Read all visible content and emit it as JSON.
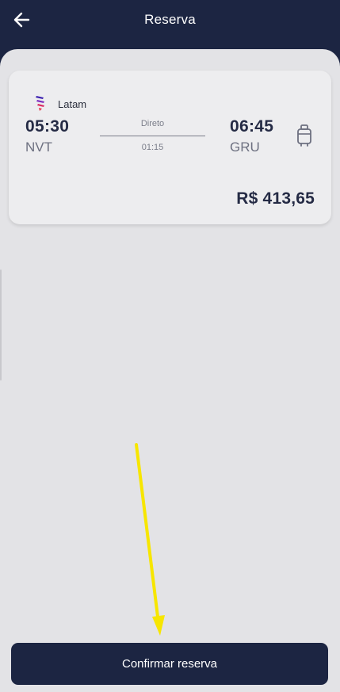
{
  "header": {
    "title": "Reserva",
    "back_icon": "arrow-left-icon"
  },
  "flight": {
    "airline": "Latam",
    "airline_logo": "latam-logo",
    "departure_time": "05:30",
    "departure_code": "NVT",
    "arrival_time": "06:45",
    "arrival_code": "GRU",
    "stops": "Direto",
    "duration": "01:15",
    "baggage_icon": "luggage-icon",
    "price": "R$ 413,65"
  },
  "footer": {
    "confirm_label": "Confirmar reserva"
  },
  "colors": {
    "header_bg": "#1c2542",
    "content_bg": "#e3e3e6",
    "card_bg": "#ededef",
    "annotation_arrow": "#f7e600"
  }
}
